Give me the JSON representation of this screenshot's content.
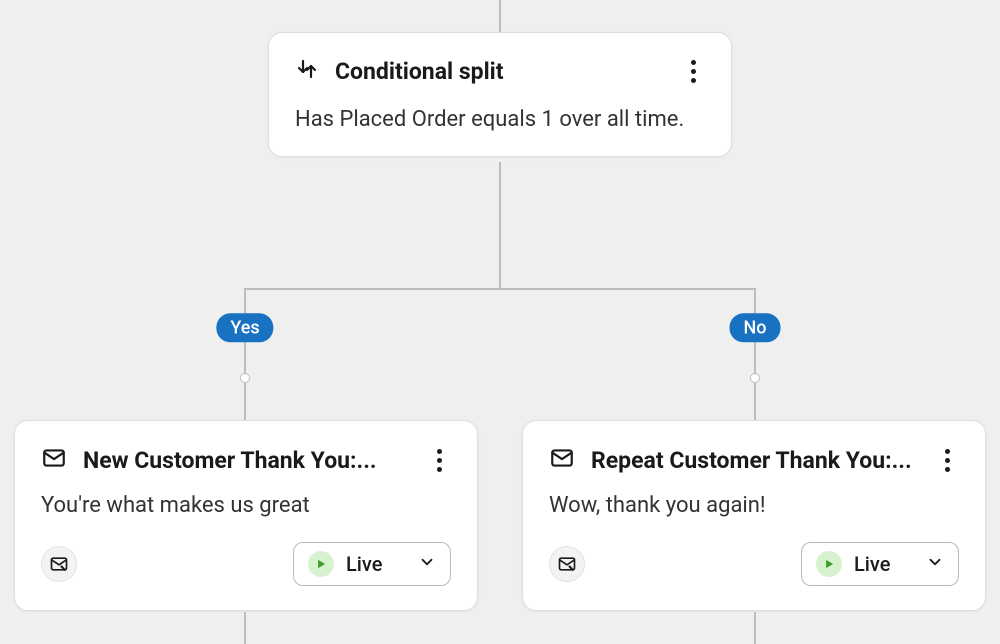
{
  "split_node": {
    "title": "Conditional split",
    "condition": "Has Placed Order equals 1 over all time."
  },
  "branches": {
    "yes_label": "Yes",
    "no_label": "No"
  },
  "left_node": {
    "title": "New Customer Thank You:...",
    "preview": "You're what makes us great",
    "status": "Live"
  },
  "right_node": {
    "title": "Repeat Customer Thank You:...",
    "preview": "Wow, thank you again!",
    "status": "Live"
  }
}
